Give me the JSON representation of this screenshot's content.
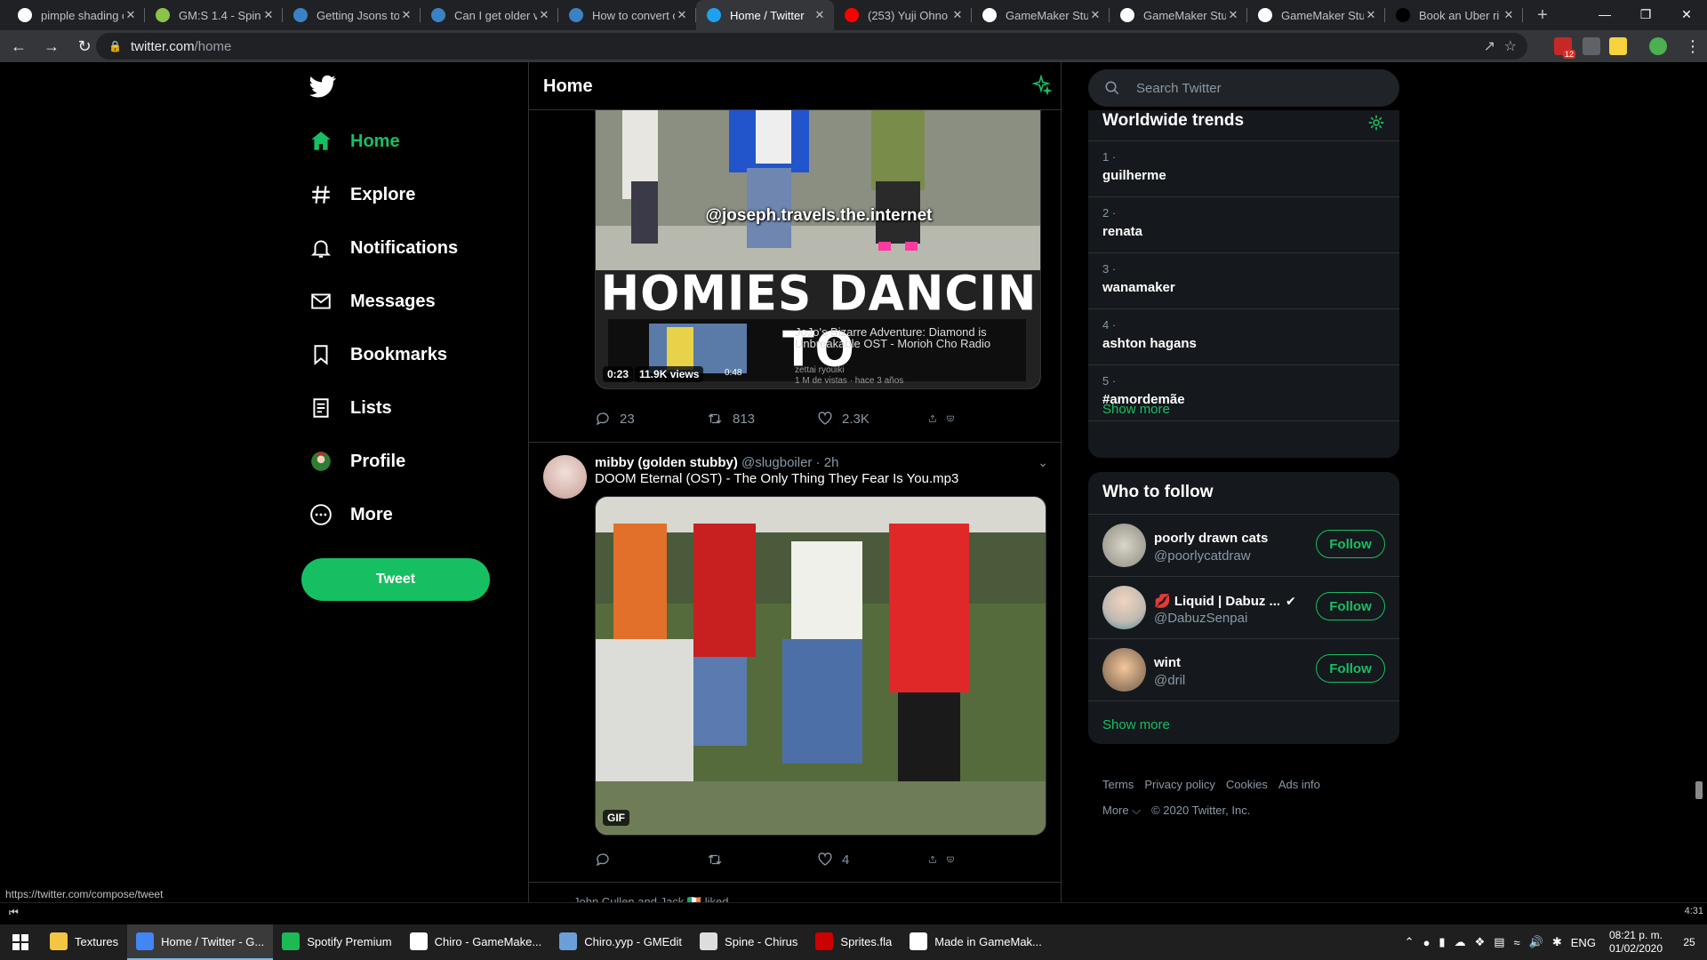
{
  "browser": {
    "tabs": [
      {
        "title": "pimple shading c",
        "icon": "google-icon",
        "color": "#ffffff"
      },
      {
        "title": "GM:S 1.4 - Spine",
        "icon": "gamemaker-forum-icon",
        "color": "#8bc34a"
      },
      {
        "title": "Getting Jsons to",
        "icon": "stackexchange-icon",
        "color": "#3b82c4"
      },
      {
        "title": "Can I get older v",
        "icon": "stackexchange-icon",
        "color": "#3b82c4"
      },
      {
        "title": "How to convert c",
        "icon": "stackexchange-icon",
        "color": "#3b82c4"
      },
      {
        "title": "Home / Twitter",
        "icon": "twitter-icon",
        "color": "#1da1f2",
        "active": true
      },
      {
        "title": "(253) Yuji Ohno",
        "icon": "youtube-icon",
        "color": "#ff0000"
      },
      {
        "title": "GameMaker Stu",
        "icon": "gamemaker-icon",
        "color": "#ffffff"
      },
      {
        "title": "GameMaker Stu",
        "icon": "gamemaker-icon",
        "color": "#ffffff"
      },
      {
        "title": "GameMaker Stu",
        "icon": "gamemaker-icon",
        "color": "#ffffff"
      },
      {
        "title": "Book an Uber ri",
        "icon": "uber-icon",
        "color": "#000000"
      }
    ],
    "url_host": "twitter.com",
    "url_path": "/home",
    "extension_badge": "12",
    "status_url": "https://twitter.com/compose/tweet"
  },
  "sidebar": {
    "items": [
      {
        "label": "Home",
        "icon": "home-icon",
        "active": true
      },
      {
        "label": "Explore",
        "icon": "hashtag-icon"
      },
      {
        "label": "Notifications",
        "icon": "bell-icon"
      },
      {
        "label": "Messages",
        "icon": "mail-icon"
      },
      {
        "label": "Bookmarks",
        "icon": "bookmark-icon"
      },
      {
        "label": "Lists",
        "icon": "list-icon"
      },
      {
        "label": "Profile",
        "icon": "profile-avatar-icon"
      },
      {
        "label": "More",
        "icon": "more-circle-icon"
      }
    ],
    "tweet_button": "Tweet"
  },
  "timeline": {
    "title": "Home",
    "tweet1": {
      "video_overlay_handle": "@joseph.travels.the.internet",
      "video_overlay_caption": "HOMIES DANCIN TO",
      "embedded_title": "JoJo's Bizarre Adventure: Diamond is Unbreakable OST - Morioh Cho Radio",
      "embedded_channel": "zettai ryouiki",
      "embedded_meta": "1 M de vistas · hace 3 años",
      "embedded_duration": "0:48",
      "duration": "0:23",
      "views": "11.9K views",
      "replies": "23",
      "retweets": "813",
      "likes": "2.3K"
    },
    "tweet2": {
      "name": "mibby (golden stubby)",
      "handle": "@slugboiler",
      "time": "2h",
      "text": "DOOM Eternal (OST) - The Only Thing They Fear Is You.mp3",
      "badge": "GIF",
      "replies": "",
      "retweets": "",
      "likes": "4"
    },
    "next_social_context": "John Cullen and Jack 🇮🇪 liked"
  },
  "right": {
    "search_placeholder": "Search Twitter",
    "trends_title": "Worldwide trends",
    "trends": [
      {
        "rank": "1 ·",
        "name": "guilherme"
      },
      {
        "rank": "2 ·",
        "name": "renata"
      },
      {
        "rank": "3 ·",
        "name": "wanamaker"
      },
      {
        "rank": "4 ·",
        "name": "ashton hagans"
      },
      {
        "rank": "5 ·",
        "name": "#amordemãe"
      }
    ],
    "trends_show_more": "Show more",
    "who_to_follow_title": "Who to follow",
    "who_to_follow": [
      {
        "name": "poorly drawn cats",
        "handle": "@poorlycatdraw",
        "button": "Follow"
      },
      {
        "name": "💋 Liquid | Dabuz ...",
        "handle": "@DabuzSenpai",
        "button": "Follow",
        "verified": true
      },
      {
        "name": "wint",
        "handle": "@dril",
        "button": "Follow"
      }
    ],
    "wtf_show_more": "Show more",
    "footer_links": [
      "Terms",
      "Privacy policy",
      "Cookies",
      "Ads info"
    ],
    "footer_more": "More ⌵",
    "copyright": "© 2020 Twitter, Inc."
  },
  "taskbar": {
    "apps": [
      {
        "label": "Textures",
        "icon": "folder-icon",
        "color": "#f4c542"
      },
      {
        "label": "Home / Twitter - G...",
        "icon": "chrome-icon",
        "color": "#4285f4",
        "active": true
      },
      {
        "label": "Spotify Premium",
        "icon": "spotify-icon",
        "color": "#1db954"
      },
      {
        "label": "Chiro - GameMake...",
        "icon": "gamemaker-icon",
        "color": "#ffffff"
      },
      {
        "label": "Chiro.yyp - GMEdit",
        "icon": "gmedit-icon",
        "color": "#6a9fd8"
      },
      {
        "label": "Spine - Chirus",
        "icon": "spine-icon",
        "color": "#dddddd"
      },
      {
        "label": "Sprites.fla",
        "icon": "flash-icon",
        "color": "#cc0000"
      },
      {
        "label": "Made in GameMak...",
        "icon": "gamemaker-icon",
        "color": "#ffffff"
      }
    ],
    "lang": "ENG",
    "time": "08:21 p. m.",
    "date": "01/02/2020",
    "notifications": "25",
    "media_time": "4:31"
  },
  "colors": {
    "accent": "#17bf63",
    "background": "#000000",
    "card": "#15181c",
    "border": "#2f3336",
    "muted": "#8899a6"
  }
}
